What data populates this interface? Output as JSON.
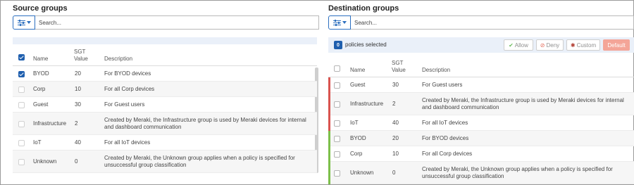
{
  "source": {
    "title": "Source groups",
    "search_placeholder": "Search...",
    "columns": {
      "name": "Name",
      "sgt_line1": "SGT",
      "sgt_line2": "Value",
      "description": "Description"
    },
    "rows": [
      {
        "name": "BYOD",
        "sgt": "20",
        "desc1": "For BYOD devices",
        "desc2": "",
        "checked": true
      },
      {
        "name": "Corp",
        "sgt": "10",
        "desc1": "For all Corp devices",
        "desc2": "",
        "checked": false
      },
      {
        "name": "Guest",
        "sgt": "30",
        "desc1": "For Guest users",
        "desc2": "",
        "checked": false
      },
      {
        "name": "Infrastructure",
        "sgt": "2",
        "desc1": "Created by Meraki, the Infrastructure group is used by Meraki devices for internal",
        "desc2": "and dashboard communication",
        "checked": false
      },
      {
        "name": "IoT",
        "sgt": "40",
        "desc1": "For all IoT devices",
        "desc2": "",
        "checked": false
      },
      {
        "name": "Unknown",
        "sgt": "0",
        "desc1": "Created by Meraki, the Unknown group applies when a policy is specified for",
        "desc2": "unsuccessful group classification",
        "checked": false
      }
    ]
  },
  "destination": {
    "title": "Destination groups",
    "search_placeholder": "Search...",
    "selected_count": "0",
    "selected_label": "policies selected",
    "buttons": {
      "allow": "Allow",
      "deny": "Deny",
      "custom": "Custom",
      "default": "Default"
    },
    "columns": {
      "name": "Name",
      "sgt_line1": "SGT",
      "sgt_line2": "Value",
      "description": "Description"
    },
    "rows": [
      {
        "name": "Guest",
        "sgt": "30",
        "desc1": "For Guest users",
        "desc2": "",
        "status": "deny"
      },
      {
        "name": "Infrastructure",
        "sgt": "2",
        "desc1": "Created by Meraki, the Infrastructure group is used by Meraki devices for internal",
        "desc2": "and dashboard communication",
        "status": "deny"
      },
      {
        "name": "IoT",
        "sgt": "40",
        "desc1": "For all IoT devices",
        "desc2": "",
        "status": "deny"
      },
      {
        "name": "BYOD",
        "sgt": "20",
        "desc1": "For BYOD devices",
        "desc2": "",
        "status": "allow"
      },
      {
        "name": "Corp",
        "sgt": "10",
        "desc1": "For all Corp devices",
        "desc2": "",
        "status": "allow"
      },
      {
        "name": "Unknown",
        "sgt": "0",
        "desc1": "Created by Meraki, the Unknown group applies when a policy is specified for",
        "desc2": "unsuccessful group classification",
        "status": "allow"
      }
    ]
  },
  "colors": {
    "accent": "#1f5fae",
    "deny": "#d9534f",
    "allow": "#7cbf4a",
    "default_button": "#f4a598"
  }
}
